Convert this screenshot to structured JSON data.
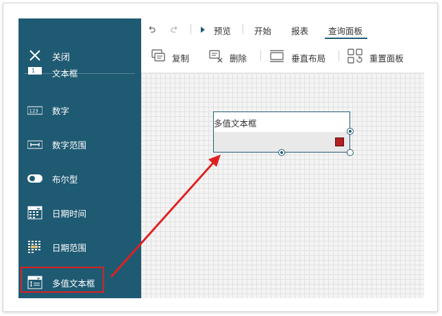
{
  "sidebar": {
    "close_label": "关闭",
    "items": [
      {
        "label": "文本框",
        "icon": "textbox-icon"
      },
      {
        "label": "数字",
        "icon": "number-icon"
      },
      {
        "label": "数字范围",
        "icon": "number-range-icon"
      },
      {
        "label": "布尔型",
        "icon": "toggle-icon"
      },
      {
        "label": "日期时间",
        "icon": "calendar-icon"
      },
      {
        "label": "日期范围",
        "icon": "date-range-icon"
      },
      {
        "label": "多值文本框",
        "icon": "multi-textbox-icon"
      }
    ],
    "number_icon_text": "123",
    "textbox_icon_text": "1"
  },
  "toolbar_top": {
    "undo_icon": "undo-icon",
    "redo_icon": "redo-icon",
    "preview_label": "预览",
    "tabs": [
      {
        "label": "开始"
      },
      {
        "label": "报表"
      },
      {
        "label": "查询面板",
        "active": true
      }
    ]
  },
  "toolbar_actions": [
    {
      "label": "复制",
      "icon": "copy-icon"
    },
    {
      "label": "删除",
      "icon": "delete-icon"
    },
    {
      "label": "垂直布局",
      "icon": "vertical-layout-icon"
    },
    {
      "label": "重置面板",
      "icon": "reset-panel-icon"
    }
  ],
  "canvas": {
    "widget_label": "多值文本框"
  },
  "colors": {
    "sidebar_bg": "#1f5a73",
    "highlight": "#e02020",
    "accent": "#1f5a73",
    "widget_button": "#b42020"
  }
}
